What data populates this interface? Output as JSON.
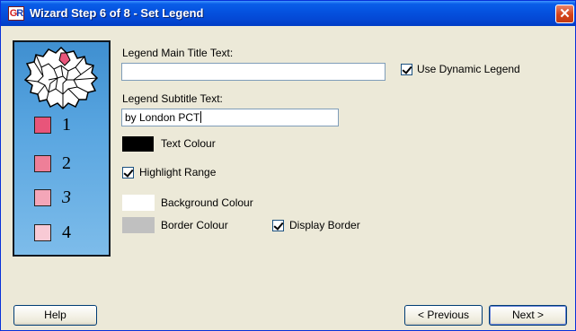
{
  "window": {
    "title": "Wizard Step 6 of 8 - Set Legend",
    "app_icon_letters": [
      "G",
      "R"
    ],
    "close_glyph": "✕"
  },
  "side_panel": {
    "map_icon": "map-icon",
    "legend_ranges": [
      {
        "label": "1",
        "color": "#e8557a"
      },
      {
        "label": "2",
        "color": "#ee7f98"
      },
      {
        "label": "3",
        "color": "#f4a6b8"
      },
      {
        "label": "4",
        "color": "#f8cad5"
      }
    ]
  },
  "form": {
    "main_title_label": "Legend Main Title Text:",
    "main_title_value": "",
    "use_dynamic_label": "Use Dynamic Legend",
    "use_dynamic_checked": true,
    "subtitle_label": "Legend Subtitle Text:",
    "subtitle_value": "by London PCT",
    "text_colour_label": "Text Colour",
    "text_colour": "#000000",
    "highlight_range_label": "Highlight Range",
    "highlight_range_checked": true,
    "background_colour_label": "Background Colour",
    "background_colour": "#ffffff",
    "border_colour_label": "Border Colour",
    "border_colour": "#c0c0c0",
    "display_border_label": "Display Border",
    "display_border_checked": true
  },
  "buttons": {
    "help": "Help",
    "previous": "< Previous",
    "next": "Next >"
  }
}
